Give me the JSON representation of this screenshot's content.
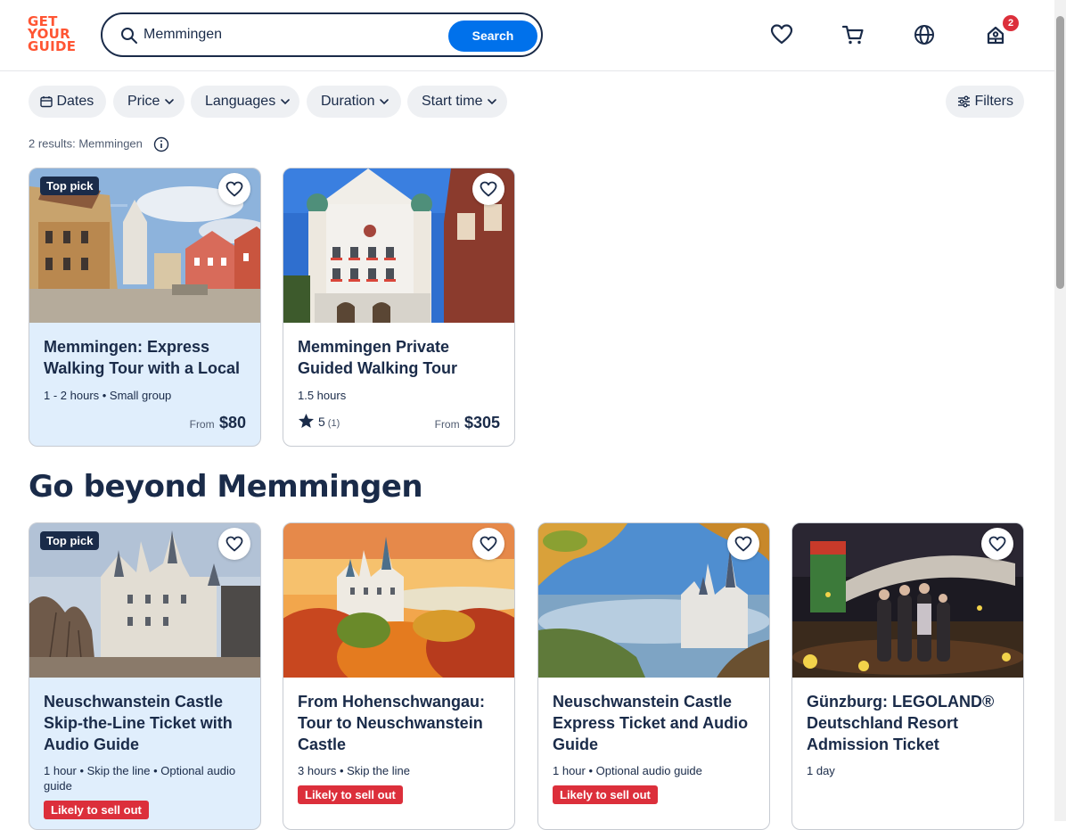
{
  "header": {
    "logo_lines": [
      "GET",
      "YOUR",
      "GUIDE"
    ],
    "search_value": "Memmingen",
    "search_button": "Search",
    "cart_badge": "2"
  },
  "filters": {
    "dates": "Dates",
    "price": "Price",
    "languages": "Languages",
    "duration": "Duration",
    "start_time": "Start time",
    "filters": "Filters"
  },
  "results_text": "2 results: Memmingen",
  "results_cards": [
    {
      "badge": "Top pick",
      "title": "Memmingen: Express Walking Tour with a Local",
      "meta": "1 - 2 hours • Small group",
      "from": "From",
      "price": "$80"
    },
    {
      "title": "Memmingen Private Guided Walking Tour",
      "meta": "1.5 hours",
      "rating": "5",
      "reviews": "(1)",
      "from": "From",
      "price": "$305"
    }
  ],
  "beyond_title": "Go beyond Memmingen",
  "beyond_cards": [
    {
      "badge": "Top pick",
      "title": "Neuschwanstein Castle Skip-the-Line Ticket with Audio Guide",
      "meta": "1 hour • Skip the line • Optional audio guide",
      "tag": "Likely to sell out"
    },
    {
      "title": "From Hohenschwangau: Tour to Neuschwanstein Castle",
      "meta": "3 hours • Skip the line",
      "tag": "Likely to sell out"
    },
    {
      "title": "Neuschwanstein Castle Express Ticket and Audio Guide",
      "meta": "1 hour • Optional audio guide",
      "tag": "Likely to sell out"
    },
    {
      "title": "Günzburg: LEGOLAND® Deutschland Resort Admission Ticket",
      "meta": "1 day"
    }
  ],
  "colors": {
    "brand": "#ff5533",
    "primary": "#0071eb",
    "navy": "#1a2b49",
    "sellout": "#dc2f3b",
    "toppick_bg": "#e0eefc"
  }
}
